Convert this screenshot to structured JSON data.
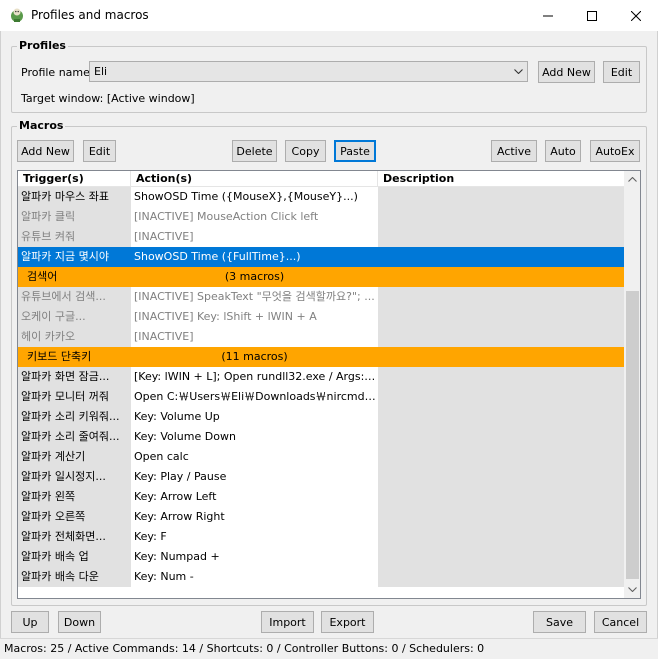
{
  "window": {
    "title": "Profiles and macros",
    "icon": "app-icon"
  },
  "profiles": {
    "group_label": "Profiles",
    "profile_name_label": "Profile name",
    "profile_value": "Eli",
    "add_new": "Add New",
    "edit": "Edit",
    "target_window": "Target window: [Active window]"
  },
  "macros": {
    "group_label": "Macros",
    "toolbar": {
      "add_new": "Add New",
      "edit": "Edit",
      "delete": "Delete",
      "copy": "Copy",
      "paste": "Paste",
      "active": "Active",
      "auto": "Auto",
      "autoex": "AutoEx"
    },
    "columns": [
      "Trigger(s)",
      "Action(s)",
      "Description"
    ],
    "rows": [
      {
        "trigger": "알파카 마우스 좌표",
        "action": "ShowOSD Time ({MouseX},{MouseY}...)",
        "description": "",
        "state": "normal"
      },
      {
        "trigger": "알파카 클릭",
        "action": "[INACTIVE]  MouseAction Click left",
        "description": "",
        "state": "inactive"
      },
      {
        "trigger": "유튜브 켜줘",
        "action": "[INACTIVE]",
        "description": "",
        "state": "inactive"
      },
      {
        "trigger": "알파카 지금 몇시야",
        "action": "ShowOSD Time ({FullTime}...)",
        "description": "",
        "state": "selected"
      },
      {
        "trigger": "검색어",
        "action": "(3 macros)",
        "description": "",
        "state": "group"
      },
      {
        "trigger": "유튜브에서 검색...",
        "action": "[INACTIVE]  SpeakText \"무엇을 검색할까요?\"; ...",
        "description": "",
        "state": "inactive"
      },
      {
        "trigger": "오케이 구글...",
        "action": "[INACTIVE]  Key: lShift + lWIN + A",
        "description": "",
        "state": "inactive"
      },
      {
        "trigger": "헤이 카카오",
        "action": "[INACTIVE]",
        "description": "",
        "state": "inactive"
      },
      {
        "trigger": "키보드 단축키",
        "action": "(11 macros)",
        "description": "",
        "state": "group"
      },
      {
        "trigger": "알파카 화면 잠금...",
        "action": "[Key: lWIN + L]; Open rundll32.exe / Args: us...",
        "description": "",
        "state": "normal"
      },
      {
        "trigger": "알파카 모니터 꺼줘",
        "action": "Open C:￦Users￦Eli￦Downloads￦nircmd-x64...",
        "description": "",
        "state": "normal"
      },
      {
        "trigger": "알파카 소리 키워줘...",
        "action": "Key: Volume Up",
        "description": "",
        "state": "normal"
      },
      {
        "trigger": "알파카 소리 줄여줘...",
        "action": "Key: Volume Down",
        "description": "",
        "state": "normal"
      },
      {
        "trigger": "알파카 계산기",
        "action": "Open calc",
        "description": "",
        "state": "normal"
      },
      {
        "trigger": "알파카 일시정지...",
        "action": "Key: Play / Pause",
        "description": "",
        "state": "normal"
      },
      {
        "trigger": "알파카 왼쪽",
        "action": "Key: Arrow Left",
        "description": "",
        "state": "normal"
      },
      {
        "trigger": "알파카 오른쪽",
        "action": "Key: Arrow Right",
        "description": "",
        "state": "normal"
      },
      {
        "trigger": "알파카 전체화면...",
        "action": "Key: F",
        "description": "",
        "state": "normal"
      },
      {
        "trigger": "알파카 배속 업",
        "action": "Key: Numpad +",
        "description": "",
        "state": "normal"
      },
      {
        "trigger": "알파카 배속 다운",
        "action": "Key: Num -",
        "description": "",
        "state": "normal"
      }
    ]
  },
  "bottom_buttons": {
    "up": "Up",
    "down": "Down",
    "import": "Import",
    "export": "Export",
    "save": "Save",
    "cancel": "Cancel"
  },
  "status": "Macros: 25 / Active Commands: 14 / Shortcuts: 0 / Controller Buttons: 0 / Schedulers: 0",
  "colors": {
    "selected": "#0078d7",
    "group": "#ffa500",
    "inactive_text": "#808080",
    "gray_cell": "#e1e1e1"
  }
}
